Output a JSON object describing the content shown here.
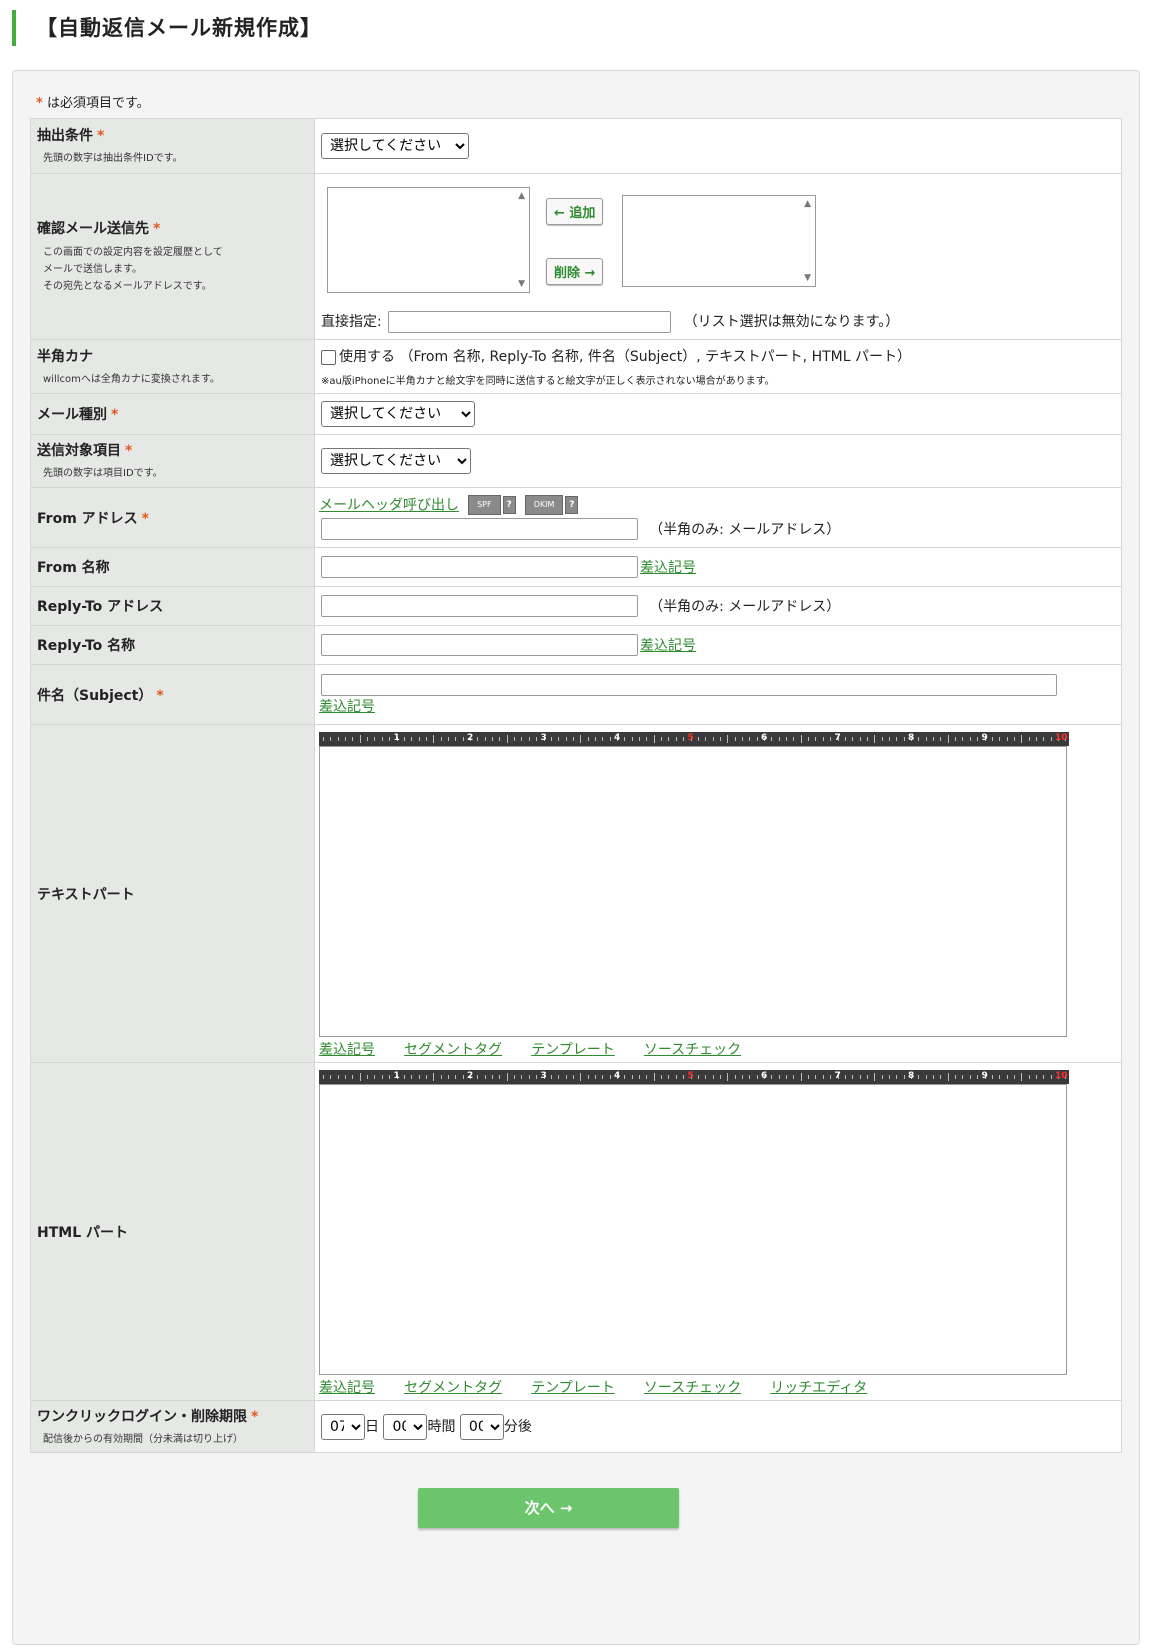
{
  "page_title": "【自動返信メール新規作成】",
  "required_note": "は必須項目です。",
  "required_mark": "*",
  "rows": {
    "extract": {
      "label": "抽出条件",
      "sub": "先頭の数字は抽出条件IDです。",
      "select_value": "選択してください"
    },
    "confirm": {
      "label": "確認メール送信先",
      "sub1": "この画面での設定内容を設定履歴として",
      "sub2": "メールで送信します。",
      "sub3": "その宛先となるメールアドレスです。",
      "add_button": "← 追加",
      "remove_button": "削除 →",
      "direct_label": "直接指定:",
      "direct_note": "（リスト選択は無効になります。）"
    },
    "hankaku": {
      "label": "半角カナ",
      "sub": "willcomへは全角カナに変換されます。",
      "checkbox_label": "使用する （From 名称, Reply-To 名称, 件名（Subject）, テキストパート, HTML パート）",
      "note": "※au版iPhoneに半角カナと絵文字を同時に送信すると絵文字が正しく表示されない場合があります。"
    },
    "mail_type": {
      "label": "メール種別",
      "select_value": "選択してください"
    },
    "target": {
      "label": "送信対象項目",
      "sub": "先頭の数字は項目IDです。",
      "select_value": "選択してください"
    },
    "from_address": {
      "label": "From アドレス",
      "header_link": "メールヘッダ呼び出し",
      "spf": "SPF",
      "dkim": "DKIM",
      "help": "?",
      "note": "（半角のみ: メールアドレス）"
    },
    "from_name": {
      "label": "From 名称",
      "link": "差込記号"
    },
    "reply_address": {
      "label": "Reply-To アドレス",
      "note": "（半角のみ: メールアドレス）"
    },
    "reply_name": {
      "label": "Reply-To 名称",
      "link": "差込記号"
    },
    "subject": {
      "label": "件名（Subject）",
      "link": "差込記号"
    },
    "text_part": {
      "label": "テキストパート",
      "links": [
        "差込記号",
        "セグメントタグ",
        "テンプレート",
        "ソースチェック"
      ]
    },
    "html_part": {
      "label": "HTML パート",
      "links": [
        "差込記号",
        "セグメントタグ",
        "テンプレート",
        "ソースチェック",
        "リッチエディタ"
      ]
    },
    "expire": {
      "label": "ワンクリックログイン・削除期限",
      "sub": "配信後からの有効期間（分未満は切り上げ）",
      "day_value": "07",
      "day_unit": "日",
      "hour_value": "00",
      "hour_unit": "時間",
      "min_value": "00",
      "min_unit": "分後"
    }
  },
  "ruler_numbers": [
    "1",
    "2",
    "3",
    "4",
    "5",
    "6",
    "7",
    "8",
    "9",
    "10"
  ],
  "next_button": "次へ →",
  "colors": {
    "accent": "#3fae3f",
    "link": "#2f8b2f",
    "required": "#e05a1e",
    "button": "#6cc46c"
  }
}
